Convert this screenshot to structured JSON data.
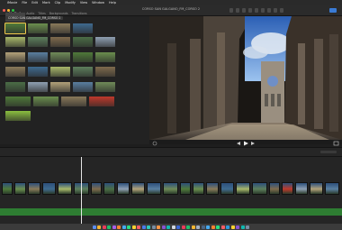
{
  "menubar": {
    "items": [
      "",
      "iMovie",
      "File",
      "Edit",
      "Mark",
      "Clip",
      "Modify",
      "View",
      "Window",
      "Help"
    ],
    "right": ""
  },
  "toolbar": {
    "project_title": "CORSO SAN GALGANO_FM_CORSO 2"
  },
  "browser": {
    "tabs": [
      "My Media",
      "Audio",
      "Titles",
      "Backgrounds",
      "Transitions"
    ],
    "active_tab": 0,
    "breadcrumb": "CORSO SAN GALGANO_FM_CORSO 2"
  },
  "viewer": {
    "timecode": "",
    "zoom": ""
  },
  "timeline": {
    "playhead_label": ""
  },
  "colors": {
    "accent": "#3a7bd5",
    "selection": "#f2c94c",
    "audio": "#2e7d32"
  },
  "icons": [
    "apple-icon",
    "play-icon",
    "skip-back-icon",
    "skip-forward-icon",
    "fullscreen-icon",
    "settings-icon"
  ]
}
